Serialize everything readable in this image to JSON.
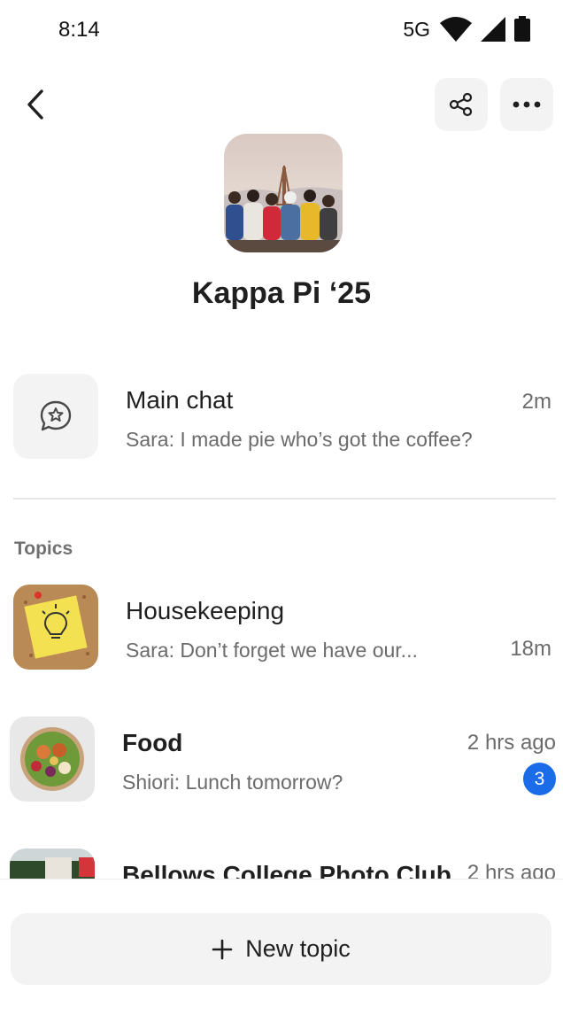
{
  "status_bar": {
    "time": "8:14",
    "network": "5G",
    "icons": [
      "wifi-icon",
      "signal-icon",
      "battery-icon"
    ]
  },
  "header": {
    "back_icon": "chevron-left-icon",
    "share_icon": "share-icon",
    "more_icon": "more-horizontal-icon"
  },
  "group": {
    "name": "Kappa Pi ‘25"
  },
  "main_chat": {
    "icon": "chat-star-icon",
    "title": "Main chat",
    "preview": "Sara: I made pie who’s got the coffee?",
    "time": "2m"
  },
  "topics": {
    "label": "Topics",
    "items": [
      {
        "title": "Housekeeping",
        "preview": "Sara: Don’t forget we have our...",
        "time": "18m"
      },
      {
        "title": "Food",
        "preview": "Shiori: Lunch tomorrow?",
        "time": "2 hrs ago",
        "unread": "3"
      },
      {
        "title": "Bellows College Photo Club",
        "time": "2 hrs ago"
      }
    ]
  },
  "new_topic": {
    "icon": "plus-icon",
    "label": "New topic"
  },
  "colors": {
    "accent": "#1a6ce8",
    "button_bg": "#f3f3f3",
    "text_primary": "#1f1f1f",
    "text_secondary": "#6b6b6b"
  }
}
